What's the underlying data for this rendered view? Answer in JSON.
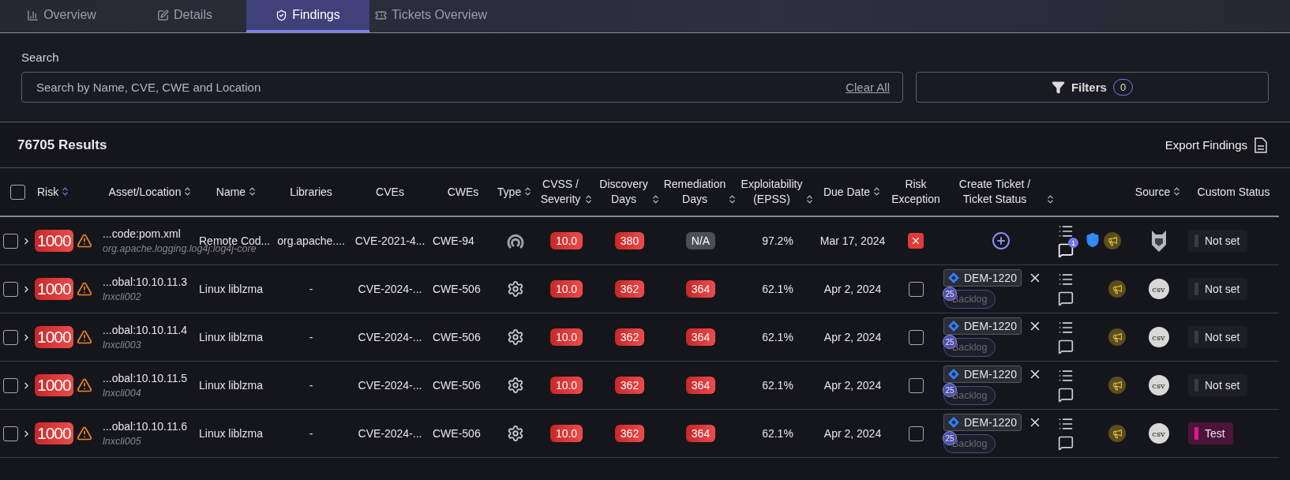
{
  "tabs": [
    {
      "label": "Overview",
      "selected": false
    },
    {
      "label": "Details",
      "selected": false
    },
    {
      "label": "Findings",
      "selected": true
    },
    {
      "label": "Tickets Overview",
      "selected": false
    }
  ],
  "search": {
    "label": "Search",
    "placeholder": "Search by Name, CVE, CWE and Location",
    "clear": "Clear All"
  },
  "filters": {
    "label": "Filters",
    "count": "0"
  },
  "results": {
    "count": "76705 Results",
    "export": "Export Findings"
  },
  "table": {
    "select_all": {
      "checked": false
    },
    "columns": [
      {
        "label": "Risk",
        "sortable": true,
        "sorted": true
      },
      {
        "label": "Asset/Location",
        "sortable": true,
        "sorted": false
      },
      {
        "label": "Name",
        "sortable": true,
        "sorted": false
      },
      {
        "label": "Libraries",
        "sortable": false,
        "sorted": false
      },
      {
        "label": "CVEs",
        "sortable": false,
        "sorted": false
      },
      {
        "label": "CWEs",
        "sortable": false,
        "sorted": false
      },
      {
        "label": "Type",
        "sortable": true,
        "sorted": false
      },
      {
        "label": "CVSS / Severity",
        "sortable": true,
        "sorted": false
      },
      {
        "label": "Discovery Days",
        "sortable": true,
        "sorted": false
      },
      {
        "label": "Remediation Days",
        "sortable": true,
        "sorted": false
      },
      {
        "label": "Exploitability (EPSS)",
        "sortable": true,
        "sorted": false
      },
      {
        "label": "Due Date",
        "sortable": true,
        "sorted": false
      },
      {
        "label": "Risk Exception",
        "sortable": false,
        "sorted": false
      },
      {
        "label": "Create Ticket / Ticket Status",
        "sortable": true,
        "sorted": false
      },
      {
        "label": "Source",
        "sortable": true,
        "sorted": false
      },
      {
        "label": "Custom Status",
        "sortable": false,
        "sorted": false
      }
    ],
    "rows": [
      {
        "checked": false,
        "risk": "1000",
        "asset": "...code:pom.xml",
        "asset_sub": "org.apache.logging.log4j:log4j-core",
        "name": "Remote Cod...",
        "libraries": "org.apache....",
        "cves": "CVE-2021-4...",
        "cwes": "CWE-94",
        "kind": "network",
        "cvss": "10.0",
        "discovery": "380",
        "remediation": {
          "text": "N/A",
          "kind": "na"
        },
        "epss": "97.2%",
        "due_date": "Mar 17, 2024",
        "risk_exception": true,
        "ticket": null,
        "comments": "1",
        "flagged": true,
        "source": {
          "kind": "logo"
        },
        "custom_status": {
          "label": "Not set",
          "color": "#3a3b40"
        }
      },
      {
        "checked": false,
        "risk": "1000",
        "asset": "...obal:10.10.11.3",
        "asset_sub": "lnxcli002",
        "name": "Linux liblzma",
        "libraries": "-",
        "cves": "CVE-2024-...",
        "cwes": "CWE-506",
        "kind": "gear",
        "cvss": "10.0",
        "discovery": "362",
        "remediation": {
          "text": "364",
          "kind": "high"
        },
        "epss": "62.1%",
        "due_date": "Apr 2, 2024",
        "risk_exception": false,
        "ticket": {
          "id": "DEM-1220",
          "count": "25",
          "status": "Backlog"
        },
        "flagged": false,
        "source": {
          "kind": "csv",
          "label": "csv"
        },
        "custom_status": {
          "label": "Not set",
          "color": "#3a3b40"
        }
      },
      {
        "checked": false,
        "risk": "1000",
        "asset": "...obal:10.10.11.4",
        "asset_sub": "lnxcli003",
        "name": "Linux liblzma",
        "libraries": "-",
        "cves": "CVE-2024-...",
        "cwes": "CWE-506",
        "kind": "gear",
        "cvss": "10.0",
        "discovery": "362",
        "remediation": {
          "text": "364",
          "kind": "high"
        },
        "epss": "62.1%",
        "due_date": "Apr 2, 2024",
        "risk_exception": false,
        "ticket": {
          "id": "DEM-1220",
          "count": "25",
          "status": "Backlog"
        },
        "flagged": false,
        "source": {
          "kind": "csv",
          "label": "csv"
        },
        "custom_status": {
          "label": "Not set",
          "color": "#3a3b40"
        }
      },
      {
        "checked": false,
        "risk": "1000",
        "asset": "...obal:10.10.11.5",
        "asset_sub": "lnxcli004",
        "name": "Linux liblzma",
        "libraries": "-",
        "cves": "CVE-2024-...",
        "cwes": "CWE-506",
        "kind": "gear",
        "cvss": "10.0",
        "discovery": "362",
        "remediation": {
          "text": "364",
          "kind": "high"
        },
        "epss": "62.1%",
        "due_date": "Apr 2, 2024",
        "risk_exception": false,
        "ticket": {
          "id": "DEM-1220",
          "count": "25",
          "status": "Backlog"
        },
        "flagged": false,
        "source": {
          "kind": "csv",
          "label": "csv"
        },
        "custom_status": {
          "label": "Not set",
          "color": "#3a3b40"
        }
      },
      {
        "checked": false,
        "risk": "1000",
        "asset": "...obal:10.10.11.6",
        "asset_sub": "lnxcli005",
        "name": "Linux liblzma",
        "libraries": "-",
        "cves": "CVE-2024-...",
        "cwes": "CWE-506",
        "kind": "gear",
        "cvss": "10.0",
        "discovery": "362",
        "remediation": {
          "text": "364",
          "kind": "high"
        },
        "epss": "62.1%",
        "due_date": "Apr 2, 2024",
        "risk_exception": false,
        "ticket": {
          "id": "DEM-1220",
          "count": "25",
          "status": "Backlog"
        },
        "flagged": false,
        "source": {
          "kind": "csv",
          "label": "csv"
        },
        "custom_status": {
          "label": "Test",
          "color": "#e0168f"
        }
      }
    ]
  }
}
